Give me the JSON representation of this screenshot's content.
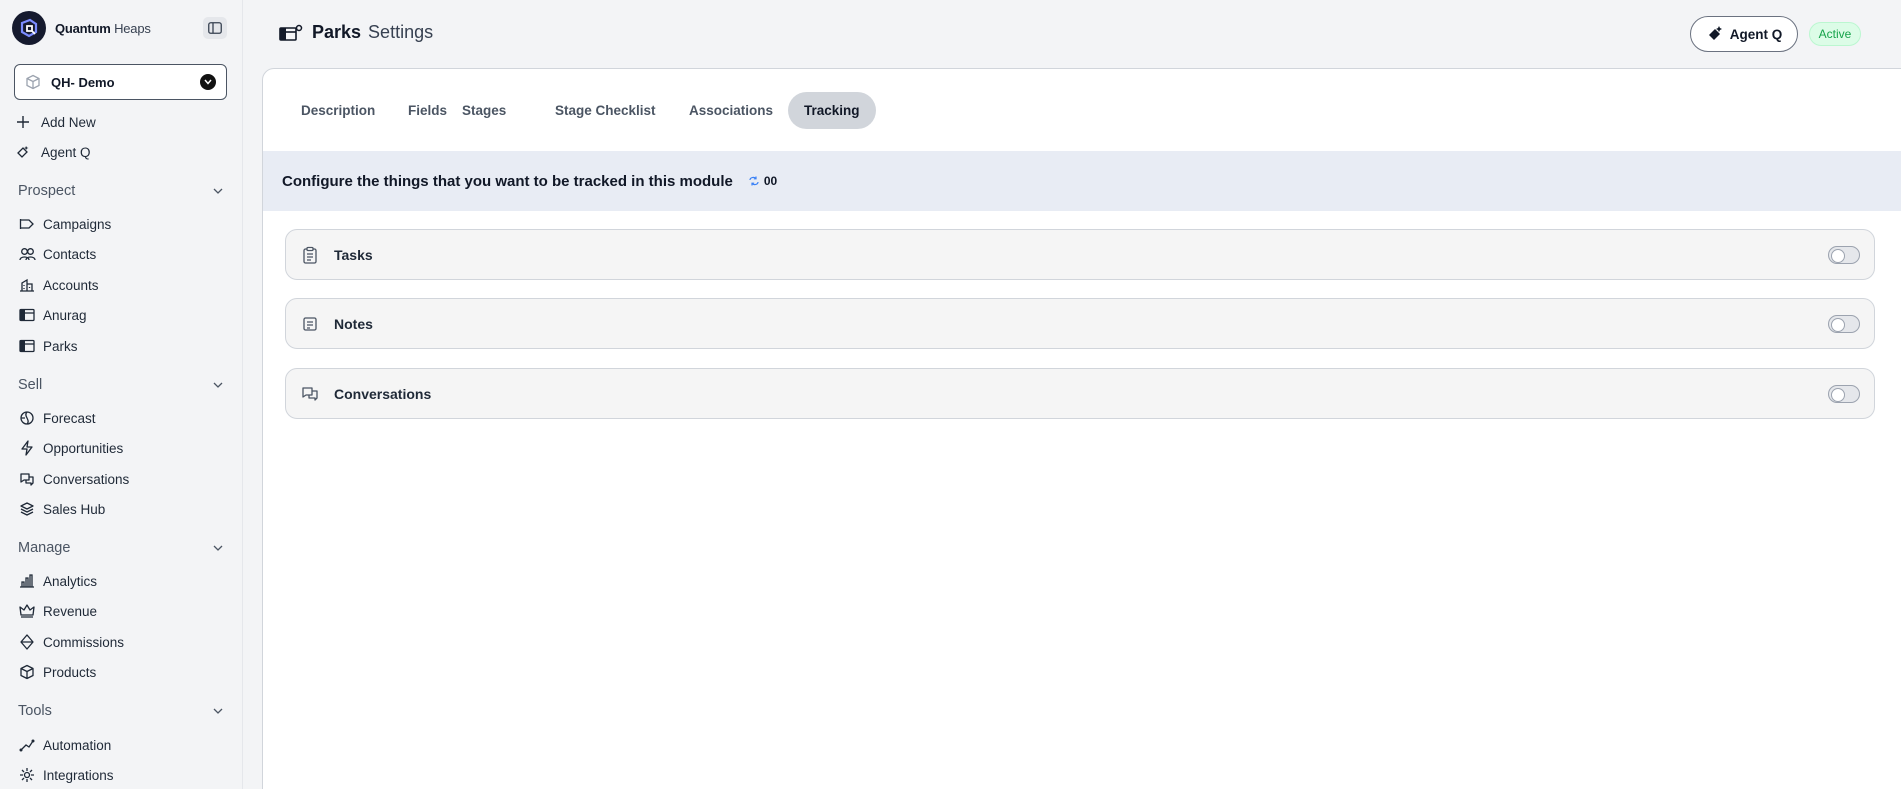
{
  "brand": {
    "name_bold": "Quantum",
    "name_rest": "Heaps"
  },
  "workspace": {
    "label": "QH- Demo"
  },
  "sidebar": {
    "top_items": [
      {
        "label": "Add New",
        "icon": "plus-icon"
      },
      {
        "label": "Agent Q",
        "icon": "agent-icon"
      }
    ],
    "sections": [
      {
        "label": "Prospect",
        "items": [
          {
            "label": "Campaigns",
            "icon": "megaphone-icon"
          },
          {
            "label": "Contacts",
            "icon": "contacts-icon"
          },
          {
            "label": "Accounts",
            "icon": "building-icon"
          },
          {
            "label": "Anurag",
            "icon": "module-icon"
          },
          {
            "label": "Parks",
            "icon": "module-icon"
          }
        ]
      },
      {
        "label": "Sell",
        "items": [
          {
            "label": "Forecast",
            "icon": "forecast-icon"
          },
          {
            "label": "Opportunities",
            "icon": "bolt-icon"
          },
          {
            "label": "Conversations",
            "icon": "chat-icon"
          },
          {
            "label": "Sales Hub",
            "icon": "layers-icon"
          }
        ]
      },
      {
        "label": "Manage",
        "items": [
          {
            "label": "Analytics",
            "icon": "bar-chart-icon"
          },
          {
            "label": "Revenue",
            "icon": "crown-icon"
          },
          {
            "label": "Commissions",
            "icon": "diamond-icon"
          },
          {
            "label": "Products",
            "icon": "cube-icon"
          }
        ]
      },
      {
        "label": "Tools",
        "items": [
          {
            "label": "Automation",
            "icon": "automation-icon"
          },
          {
            "label": "Integrations",
            "icon": "integrations-icon"
          }
        ]
      }
    ]
  },
  "header": {
    "title": "Parks",
    "subtitle": "Settings",
    "agent_button": "Agent Q",
    "status": "Active"
  },
  "tabs": [
    {
      "label": "Description"
    },
    {
      "label": "Fields"
    },
    {
      "label": "Stages"
    },
    {
      "label": "Stage Checklist"
    },
    {
      "label": "Associations"
    },
    {
      "label": "Tracking",
      "active": true
    }
  ],
  "banner": {
    "text": "Configure the things that you want to be tracked in this module",
    "count": "00"
  },
  "tracking_items": [
    {
      "label": "Tasks",
      "icon": "clipboard-icon",
      "enabled": false
    },
    {
      "label": "Notes",
      "icon": "notes-icon",
      "enabled": false
    },
    {
      "label": "Conversations",
      "icon": "chat-icon",
      "enabled": false
    }
  ],
  "colors": {
    "accent": "#151a2e",
    "active_badge_bg": "#dcfce7",
    "active_badge_text": "#16a34a",
    "banner_bg": "#e8ecf4"
  }
}
